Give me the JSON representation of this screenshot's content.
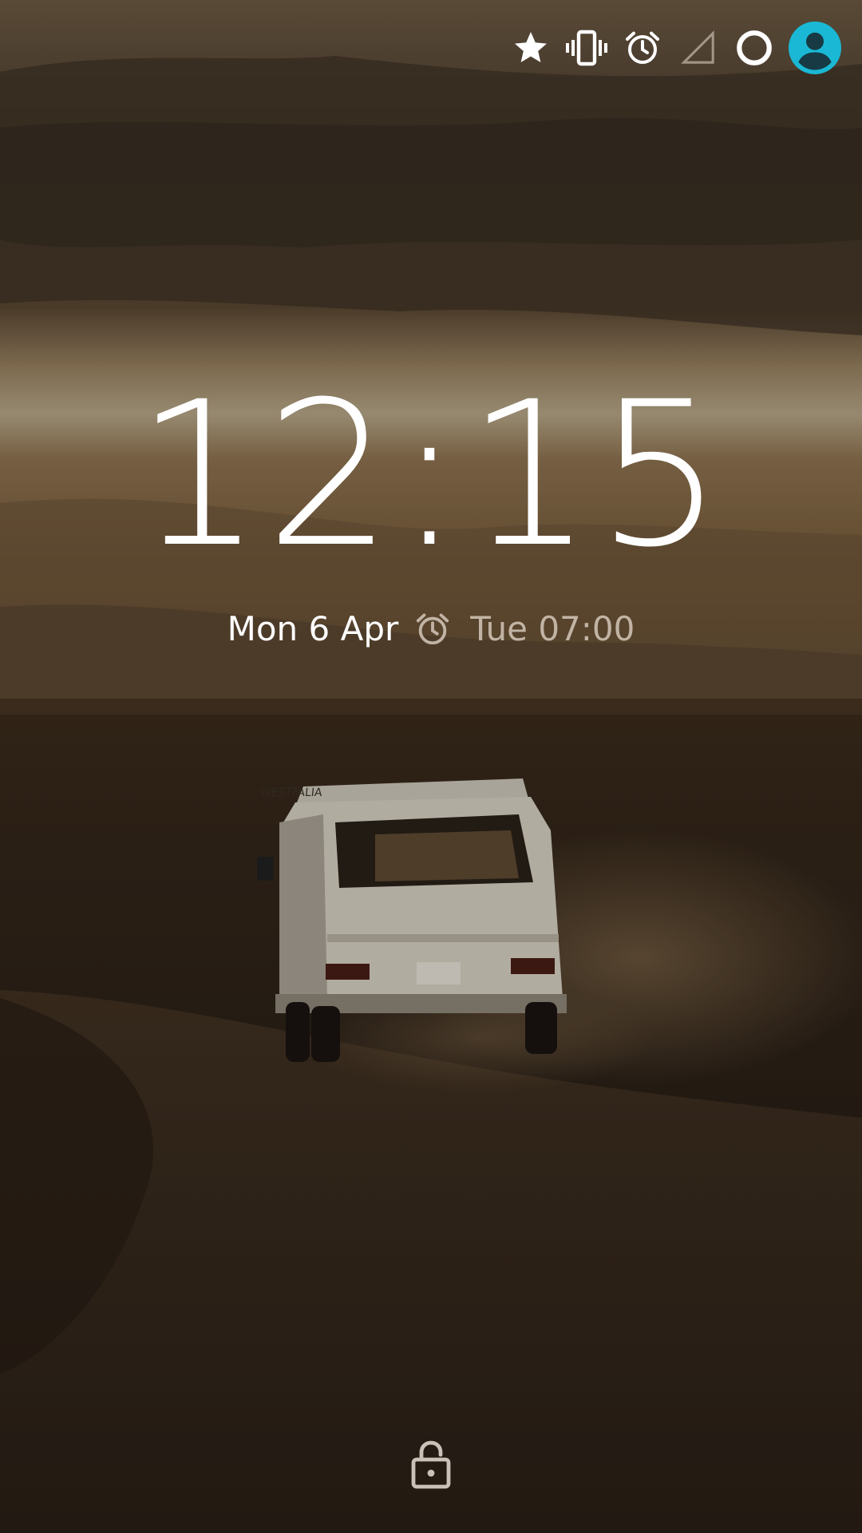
{
  "lockscreen": {
    "clock": "12:15",
    "date": "Mon 6 Apr",
    "next_alarm": "Tue 07:00"
  },
  "status_icons": [
    "star-icon",
    "vibrate-icon",
    "alarm-icon",
    "signal-icon",
    "battery-ring-icon",
    "user-avatar-icon"
  ],
  "colors": {
    "avatar_accent": "#1ab8d4",
    "text_primary": "#ffffff",
    "text_secondary": "#d9cdbf"
  }
}
